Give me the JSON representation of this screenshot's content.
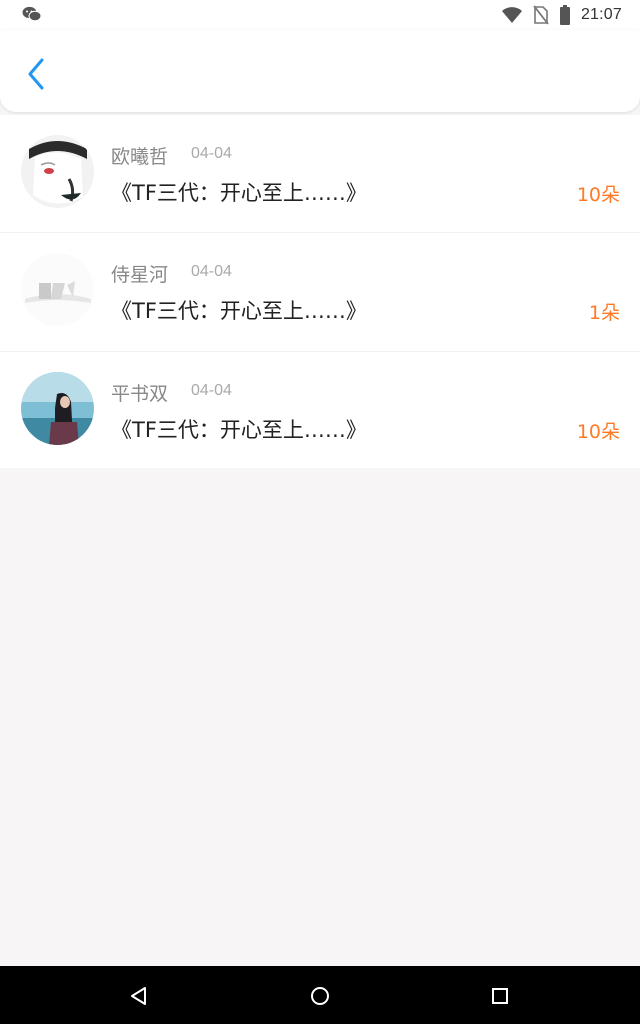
{
  "status_bar": {
    "time": "21:07",
    "icons": [
      "wechat-icon",
      "wifi-icon",
      "no-sim-icon",
      "battery-icon"
    ]
  },
  "header": {
    "back_icon": "chevron-left-icon"
  },
  "colors": {
    "accent_blue": "#2196f3",
    "count_orange": "#ff7a27"
  },
  "list": {
    "items": [
      {
        "name": "欧曦哲",
        "date": "04-04",
        "title": "《TF三代：开心至上……》",
        "count": "10朵"
      },
      {
        "name": "侍星河",
        "date": "04-04",
        "title": "《TF三代：开心至上……》",
        "count": "1朵"
      },
      {
        "name": "平书双",
        "date": "04-04",
        "title": "《TF三代：开心至上……》",
        "count": "10朵"
      }
    ]
  },
  "nav_bar": {
    "buttons": [
      "back-triangle-icon",
      "home-circle-icon",
      "recents-square-icon"
    ]
  }
}
